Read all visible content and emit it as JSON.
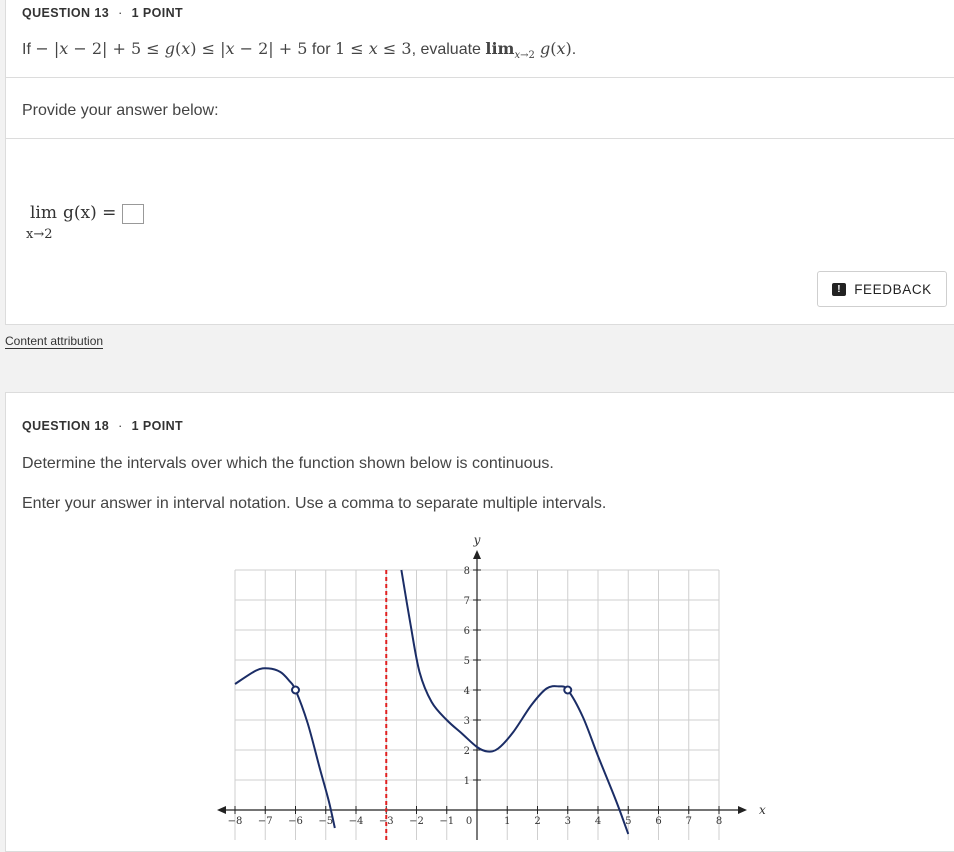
{
  "q13": {
    "header": "QUESTION 13",
    "points": "1 POINT",
    "prompt": "Provide your answer below:",
    "lim_word": "lim",
    "lim_sub": "x→2",
    "lim_expr": "g(x) ="
  },
  "feedback": {
    "label": "FEEDBACK"
  },
  "attribution": {
    "label": "Content attribution"
  },
  "q18": {
    "header": "QUESTION 18",
    "points": "1 POINT",
    "text": "Determine the intervals over which the function shown below is continuous.",
    "instructions": "Enter your answer in interval notation. Use a comma to separate multiple intervals."
  },
  "graph": {
    "x_ticks": [
      -8,
      -7,
      -6,
      -5,
      -4,
      -3,
      -2,
      -1,
      0,
      1,
      2,
      3,
      4,
      5,
      6,
      7,
      8
    ],
    "y_ticks": [
      1,
      2,
      3,
      4,
      5,
      6,
      7,
      8
    ],
    "x_axis_label": "x",
    "y_axis_label": "y",
    "xlim": [
      -8,
      8
    ],
    "ylim": [
      0,
      8
    ],
    "asymptote_x": -3,
    "asymptote_color": "#e02020",
    "curve_color": "#1b2d66",
    "open_points": [
      {
        "x": -6,
        "y": 4
      },
      {
        "x": 3,
        "y": 4
      }
    ],
    "curve_left": [
      [
        -8,
        4.2
      ],
      [
        -7.3,
        4.65
      ],
      [
        -6.9,
        4.72
      ],
      [
        -6.5,
        4.6
      ],
      [
        -6.2,
        4.3
      ],
      [
        -6,
        4
      ],
      [
        -5.6,
        2.9
      ],
      [
        -5.2,
        1.4
      ],
      [
        -4.9,
        0.3
      ],
      [
        -4.7,
        -0.6
      ]
    ],
    "curve_right": [
      [
        -2.5,
        8
      ],
      [
        -2.2,
        6.2
      ],
      [
        -1.9,
        4.6
      ],
      [
        -1.5,
        3.6
      ],
      [
        -1,
        3.0
      ],
      [
        -0.5,
        2.55
      ],
      [
        0,
        2.1
      ],
      [
        0.35,
        1.95
      ],
      [
        0.7,
        2.05
      ],
      [
        1.2,
        2.6
      ],
      [
        1.8,
        3.5
      ],
      [
        2.3,
        4.05
      ],
      [
        2.7,
        4.12
      ],
      [
        3,
        4
      ],
      [
        3.5,
        3.1
      ],
      [
        4,
        1.8
      ],
      [
        4.6,
        0.3
      ],
      [
        5,
        -0.8
      ]
    ]
  }
}
